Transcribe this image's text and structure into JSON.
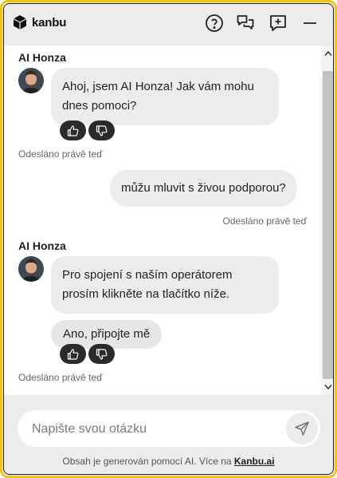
{
  "header": {
    "brand": "kanbu",
    "help_icon": "question-circle-icon",
    "chat_icon": "chat-bubbles-icon",
    "new_chat_icon": "add-message-icon",
    "minimize_icon": "minus-icon"
  },
  "messages": [
    {
      "sender": "AI Honza",
      "text_lines": [
        "Ahoj, jsem AI Honza! Jak vám mohu",
        "dnes pomoci?"
      ],
      "time": "Odesláno právě teď"
    },
    {
      "text": "můžu mluvit s živou podporou?",
      "time": "Odesláno právě teď"
    },
    {
      "sender": "AI Honza",
      "text_lines": [
        "Pro spojení s naším operátorem",
        "prosím klikněte na tlačítko níže."
      ],
      "quick_reply": "Ano, připojte mě",
      "time": "Odesláno právě teď"
    }
  ],
  "input": {
    "placeholder": "Napište svou otázku",
    "value": ""
  },
  "disclaimer": {
    "prefix": "Obsah je generován pomocí AI. Více na ",
    "link": "Kanbu.ai"
  },
  "colors": {
    "frame": "#f1c40f",
    "header_bg": "#ececec",
    "bubble": "#ececec",
    "feedback_bg": "#2b2b2b"
  }
}
